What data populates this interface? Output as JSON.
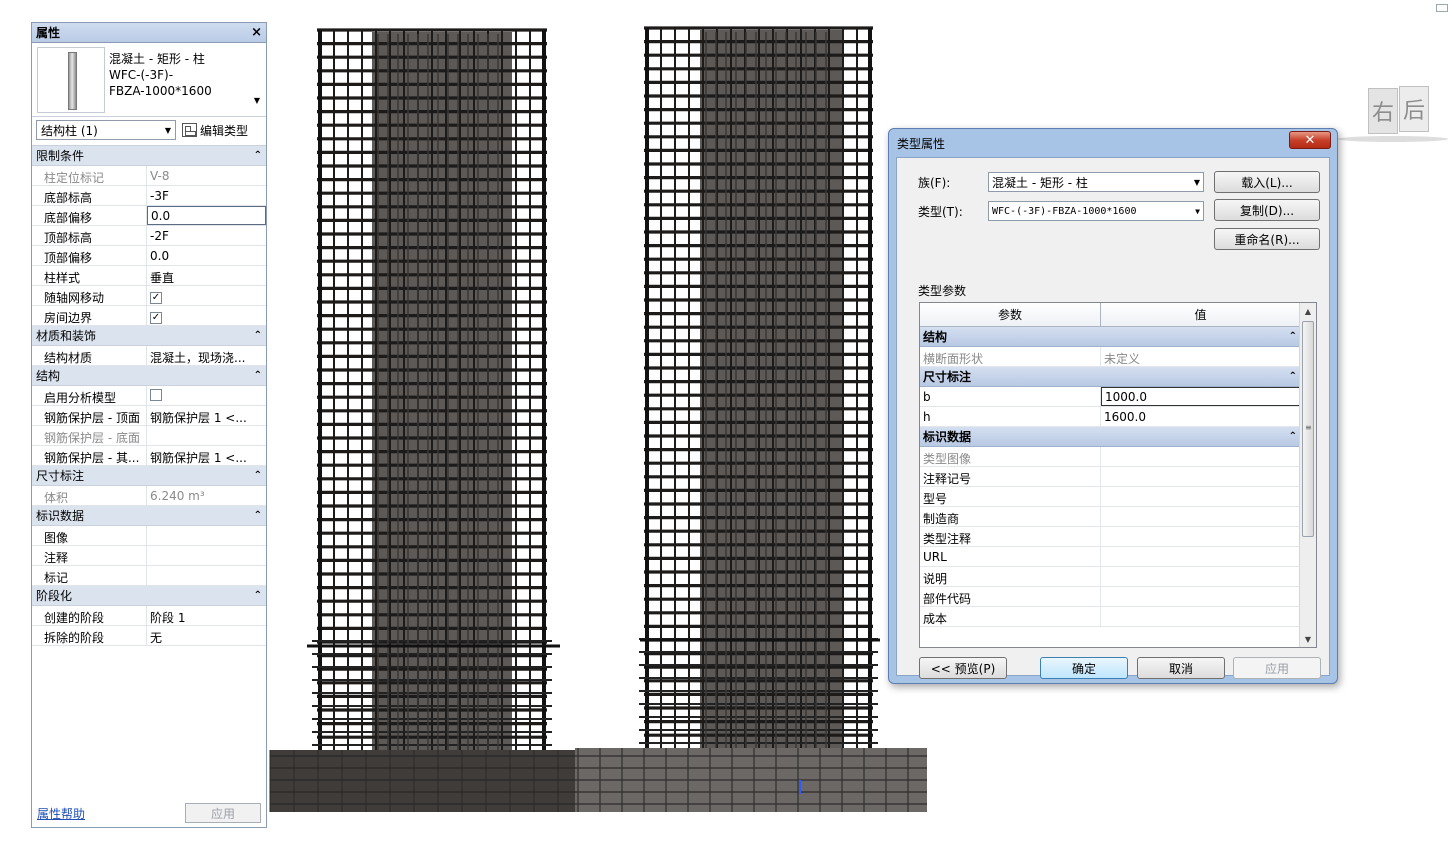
{
  "properties": {
    "title": "属性",
    "close": "×",
    "type_name_lines": [
      "混凝土 - 矩形 - 柱",
      "WFC-(-3F)-",
      "FBZA-1000*1600"
    ],
    "instance_filter": "结构柱 (1)",
    "edit_type_label": "编辑类型",
    "groups": [
      {
        "label": "限制条件",
        "rows": [
          {
            "key": "柱定位标记",
            "value": "V-8",
            "disabled": true
          },
          {
            "key": "底部标高",
            "value": "-3F"
          },
          {
            "key": "底部偏移",
            "value": "0.0",
            "editing": true
          },
          {
            "key": "顶部标高",
            "value": "-2F"
          },
          {
            "key": "顶部偏移",
            "value": "0.0"
          },
          {
            "key": "柱样式",
            "value": "垂直"
          },
          {
            "key": "随轴网移动",
            "checkbox": true,
            "checked": true
          },
          {
            "key": "房间边界",
            "checkbox": true,
            "checked": true
          }
        ]
      },
      {
        "label": "材质和装饰",
        "rows": [
          {
            "key": "结构材质",
            "value": "混凝土，现场浇..."
          }
        ]
      },
      {
        "label": "结构",
        "rows": [
          {
            "key": "启用分析模型",
            "checkbox": true,
            "checked": false
          },
          {
            "key": "钢筋保护层 - 顶面",
            "value": "钢筋保护层 1 <..."
          },
          {
            "key": "钢筋保护层 - 底面",
            "value": "",
            "disabled": true
          },
          {
            "key": "钢筋保护层 - 其...",
            "value": "钢筋保护层 1 <..."
          }
        ]
      },
      {
        "label": "尺寸标注",
        "rows": [
          {
            "key": "体积",
            "value": "6.240 m³",
            "disabled": true
          }
        ]
      },
      {
        "label": "标识数据",
        "rows": [
          {
            "key": "图像",
            "value": ""
          },
          {
            "key": "注释",
            "value": ""
          },
          {
            "key": "标记",
            "value": ""
          }
        ]
      },
      {
        "label": "阶段化",
        "rows": [
          {
            "key": "创建的阶段",
            "value": "阶段 1"
          },
          {
            "key": "拆除的阶段",
            "value": "无"
          }
        ]
      }
    ],
    "help_link": "属性帮助",
    "apply_label": "应用"
  },
  "viewcube": {
    "face_right": "右",
    "face_back": "后"
  },
  "dialog": {
    "title": "类型属性",
    "close": "✕",
    "family_label": "族(F):",
    "family_value": "混凝土 - 矩形 - 柱",
    "type_label": "类型(T):",
    "type_value": "WFC-(-3F)-FBZA-1000*1600",
    "load_btn": "载入(L)...",
    "duplicate_btn": "复制(D)...",
    "rename_btn": "重命名(R)...",
    "section_label": "类型参数",
    "col_param": "参数",
    "col_value": "值",
    "groups": [
      {
        "label": "结构",
        "rows": [
          {
            "key": "横断面形状",
            "value": "未定义",
            "disabled": true
          }
        ]
      },
      {
        "label": "尺寸标注",
        "rows": [
          {
            "key": "b",
            "value": "1000.0",
            "editing": true
          },
          {
            "key": "h",
            "value": "1600.0"
          }
        ]
      },
      {
        "label": "标识数据",
        "rows": [
          {
            "key": "类型图像",
            "value": "",
            "disabled": true
          },
          {
            "key": "注释记号",
            "value": ""
          },
          {
            "key": "型号",
            "value": ""
          },
          {
            "key": "制造商",
            "value": ""
          },
          {
            "key": "类型注释",
            "value": ""
          },
          {
            "key": "URL",
            "value": ""
          },
          {
            "key": "说明",
            "value": ""
          },
          {
            "key": "部件代码",
            "value": ""
          },
          {
            "key": "成本",
            "value": ""
          }
        ]
      }
    ],
    "preview_btn": "<< 预览(P)",
    "ok_btn": "确定",
    "cancel_btn": "取消",
    "apply_btn": "应用"
  }
}
